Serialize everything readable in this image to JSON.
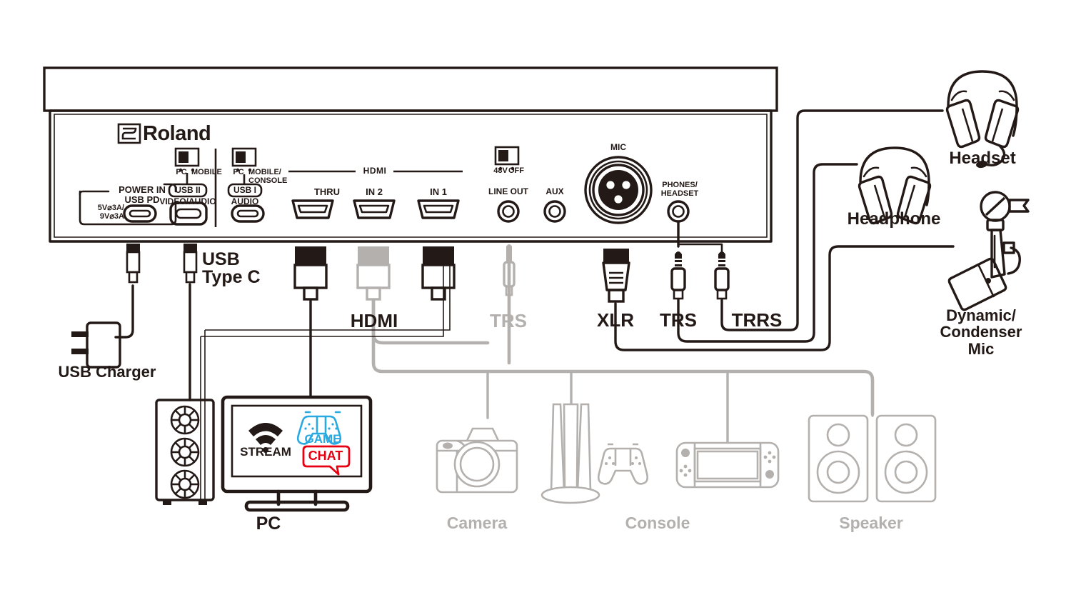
{
  "diagram": {
    "title": "Roland audio interface rear-panel connection diagram",
    "brand": "Roland",
    "colors": {
      "ink": "#231916",
      "gray": "#b3b0ae",
      "game_blue": "#29a9e1",
      "chat_red": "#e60012"
    }
  },
  "panel": {
    "brand_label": "Roland",
    "switch_usb2": {
      "left": "PC",
      "right": "MOBILE"
    },
    "switch_usb1": {
      "left": "PC",
      "right": "MOBILE/",
      "right2": "CONSOLE"
    },
    "phantom_switch": {
      "left": "48V",
      "right": "OFF"
    },
    "ports": [
      {
        "id": "power-in",
        "box_top": "POWER IN",
        "name": "USB PD",
        "spec1": "5V⌀3A/",
        "spec2": "9V⌀3A",
        "type": "usb-c"
      },
      {
        "id": "usb-2",
        "badge": "USB II",
        "name": "VIDEO/AUDIO",
        "type": "usb-c"
      },
      {
        "id": "usb-1",
        "badge": "USB I",
        "name": "AUDIO",
        "type": "usb-c"
      },
      {
        "id": "hdmi-thru",
        "group": "HDMI",
        "name": "THRU",
        "type": "hdmi"
      },
      {
        "id": "hdmi-in2",
        "group": "HDMI",
        "name": "IN 2",
        "type": "hdmi"
      },
      {
        "id": "hdmi-in1",
        "group": "HDMI",
        "name": "IN 1",
        "type": "hdmi"
      },
      {
        "id": "line-out",
        "name": "LINE OUT",
        "type": "trs-jack"
      },
      {
        "id": "aux",
        "name": "AUX",
        "type": "trs-jack"
      },
      {
        "id": "mic",
        "name": "MIC",
        "type": "xlr-jack"
      },
      {
        "id": "phones-headset",
        "name": "PHONES/",
        "name2": "HEADSET",
        "type": "trs-jack"
      }
    ],
    "group_label_hdmi": "HDMI"
  },
  "cable_labels": [
    {
      "id": "usb-type-c",
      "line1": "USB",
      "line2": "Type C",
      "color": "ink"
    },
    {
      "id": "hdmi",
      "line1": "HDMI",
      "color": "ink"
    },
    {
      "id": "trs-gray",
      "line1": "TRS",
      "color": "gray"
    },
    {
      "id": "xlr",
      "line1": "XLR",
      "color": "ink"
    },
    {
      "id": "trs",
      "line1": "TRS",
      "color": "ink"
    },
    {
      "id": "trrs",
      "line1": "TRRS",
      "color": "ink"
    }
  ],
  "devices": [
    {
      "id": "usb-charger",
      "label": "USB Charger",
      "color": "ink"
    },
    {
      "id": "pc",
      "label": "PC",
      "color": "ink"
    },
    {
      "id": "camera",
      "label": "Camera",
      "color": "gray"
    },
    {
      "id": "console",
      "label": "Console",
      "color": "gray"
    },
    {
      "id": "speaker",
      "label": "Speaker",
      "color": "gray"
    },
    {
      "id": "headset",
      "label": "Headset",
      "color": "ink"
    },
    {
      "id": "headphone",
      "label": "Headphone",
      "color": "ink"
    },
    {
      "id": "dynamic-condenser-mic",
      "label": "Dynamic/",
      "label2": "Condenser Mic",
      "color": "ink"
    }
  ],
  "pc_screen": {
    "stream_label": "STREAM",
    "game_label": "GAME",
    "chat_label": "CHAT"
  }
}
